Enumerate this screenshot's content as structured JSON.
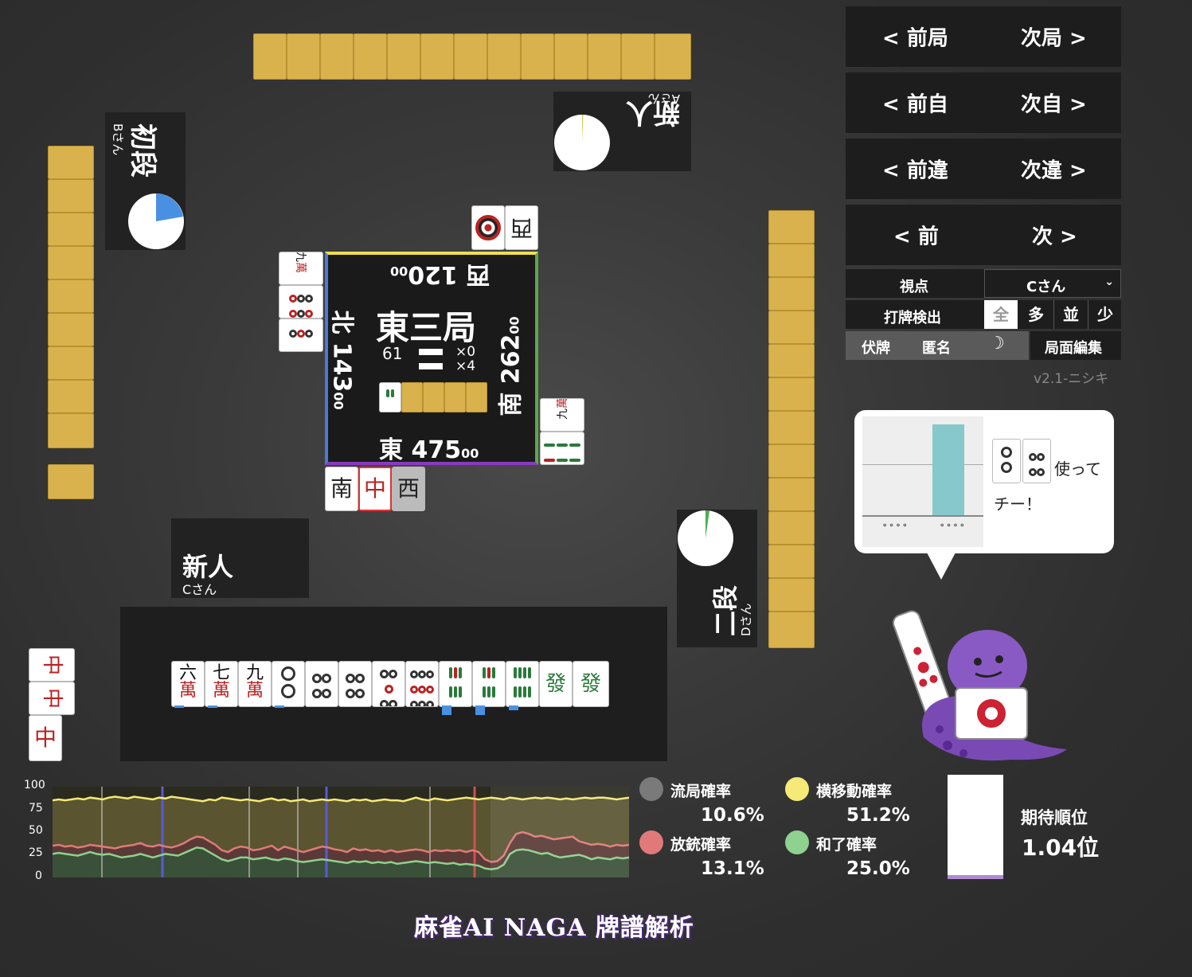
{
  "players": {
    "top": {
      "rank": "新人",
      "name": "Aさん"
    },
    "left": {
      "rank": "初段",
      "name": "Bさん"
    },
    "self": {
      "rank": "新人",
      "name": "Cさん"
    },
    "right": {
      "rank": "二段",
      "name": "Dさん"
    }
  },
  "center": {
    "round": "東三局",
    "remaining": "61",
    "honba": "×0",
    "riichi": "×4",
    "scores": {
      "west": {
        "wind": "西",
        "value": "120",
        "sub": "00"
      },
      "north": {
        "wind": "北",
        "value": "143",
        "sub": "00"
      },
      "south": {
        "wind": "南",
        "value": "262",
        "sub": "00"
      },
      "east": {
        "wind": "東",
        "value": "475",
        "sub": "00"
      }
    }
  },
  "discards": {
    "top": [
      "西",
      "◎"
    ],
    "left_wan": {
      "num": "九",
      "suit": "萬"
    },
    "right_wan": {
      "num": "九",
      "suit": "萬"
    },
    "bottom": [
      "南",
      "中",
      "西"
    ]
  },
  "hand": [
    {
      "num": "六",
      "suit": "萬"
    },
    {
      "num": "七",
      "suit": "萬"
    },
    {
      "num": "九",
      "suit": "萬"
    },
    {
      "pin": 2
    },
    {
      "pin": 4
    },
    {
      "pin": 4
    },
    {
      "pin": 5
    },
    {
      "pin": 9
    },
    {
      "sou": 7
    },
    {
      "sou": 7
    },
    {
      "sou": 8
    },
    {
      "honor": "發"
    },
    {
      "honor": "發"
    }
  ],
  "hand_bars": [
    2,
    2,
    2,
    2,
    2,
    2,
    2,
    2,
    12,
    12,
    6,
    1,
    1
  ],
  "melds": [
    "中",
    "中",
    "中"
  ],
  "nav": [
    {
      "prev": "< 前局",
      "next": "次局 >"
    },
    {
      "prev": "< 前自",
      "next": "次自 >"
    },
    {
      "prev": "< 前違",
      "next": "次違 >"
    },
    {
      "prev": "< 前",
      "next": "次 >"
    }
  ],
  "settings": {
    "viewpoint_label": "視点",
    "viewpoint_value": "Cさん",
    "detect_label": "打牌検出",
    "detect_options": [
      "全",
      "多",
      "並",
      "少"
    ],
    "hide_label": "伏牌",
    "anon_label": "匿名",
    "moon_icon": "☽",
    "edit_label": "局面編集",
    "version": "v2.1-ニシキ"
  },
  "advice": {
    "line1": "使って",
    "line2": "チー！"
  },
  "graph": {
    "y_ticks": [
      "100",
      "75",
      "50",
      "25",
      "0"
    ],
    "series": {
      "yellow": [
        85,
        86,
        85,
        86,
        87,
        86,
        88,
        87,
        86,
        88,
        89,
        88,
        87,
        89,
        88,
        87,
        86,
        88,
        87,
        89,
        88,
        87,
        86,
        85,
        84,
        86,
        85,
        88,
        87,
        86,
        85,
        86,
        85,
        84,
        86,
        87,
        85,
        86,
        84,
        85,
        86,
        84,
        85,
        86,
        85,
        86,
        85,
        84,
        86,
        85,
        86,
        84,
        85,
        86,
        85,
        85,
        84,
        86,
        88,
        86,
        85,
        87,
        86,
        85,
        86,
        87,
        88,
        87,
        86,
        87,
        88,
        87,
        86,
        88,
        87,
        86,
        87,
        88,
        87,
        88,
        87,
        86,
        87,
        86,
        87,
        88,
        87,
        88,
        88,
        87,
        86,
        87,
        88
      ],
      "red": [
        35,
        36,
        34,
        35,
        33,
        34,
        36,
        35,
        34,
        33,
        32,
        34,
        35,
        36,
        38,
        35,
        34,
        36,
        34,
        33,
        35,
        38,
        42,
        45,
        44,
        40,
        36,
        30,
        28,
        32,
        34,
        33,
        30,
        31,
        33,
        35,
        30,
        34,
        32,
        30,
        28,
        30,
        32,
        34,
        33,
        31,
        30,
        28,
        32,
        30,
        31,
        29,
        30,
        28,
        30,
        28,
        29,
        30,
        31,
        30,
        28,
        30,
        29,
        30,
        29,
        30,
        28,
        30,
        28,
        20,
        17,
        18,
        24,
        38,
        48,
        50,
        48,
        45,
        46,
        44,
        42,
        43,
        44,
        45,
        40,
        38,
        36,
        37,
        36,
        34,
        36,
        35,
        36
      ],
      "green": [
        26,
        27,
        26,
        25,
        24,
        26,
        28,
        26,
        25,
        26,
        24,
        22,
        23,
        24,
        26,
        24,
        22,
        24,
        26,
        25,
        24,
        27,
        30,
        33,
        32,
        28,
        24,
        20,
        18,
        20,
        22,
        22,
        20,
        21,
        22,
        20,
        19,
        21,
        20,
        18,
        17,
        18,
        19,
        20,
        19,
        18,
        17,
        16,
        18,
        17,
        18,
        16,
        17,
        16,
        17,
        15,
        16,
        17,
        18,
        17,
        16,
        17,
        16,
        15,
        16,
        14,
        15,
        14,
        13,
        10,
        9,
        10,
        14,
        26,
        30,
        31,
        30,
        28,
        26,
        27,
        24,
        22,
        23,
        24,
        25,
        23,
        20,
        22,
        21,
        20,
        22,
        21,
        22
      ]
    },
    "labels": {
      "ryukyoku": "流局確率",
      "ryukyoku_val": "10.6%",
      "houju": "放銃確率",
      "houju_val": "13.1%",
      "yoko": "横移動確率",
      "yoko_val": "51.2%",
      "agari": "和了確率",
      "agari_val": "25.0%",
      "rank_label": "期待順位",
      "rank_val": "1.04位"
    }
  },
  "logo": "麻雀AI NAGA 牌譜解析",
  "colors": {
    "gray": "#7a7a7a",
    "red": "#e07a7a",
    "yellow": "#f5ea78",
    "green": "#8fd18f",
    "blue": "#4a90e2",
    "teal": "#86c8cb"
  }
}
